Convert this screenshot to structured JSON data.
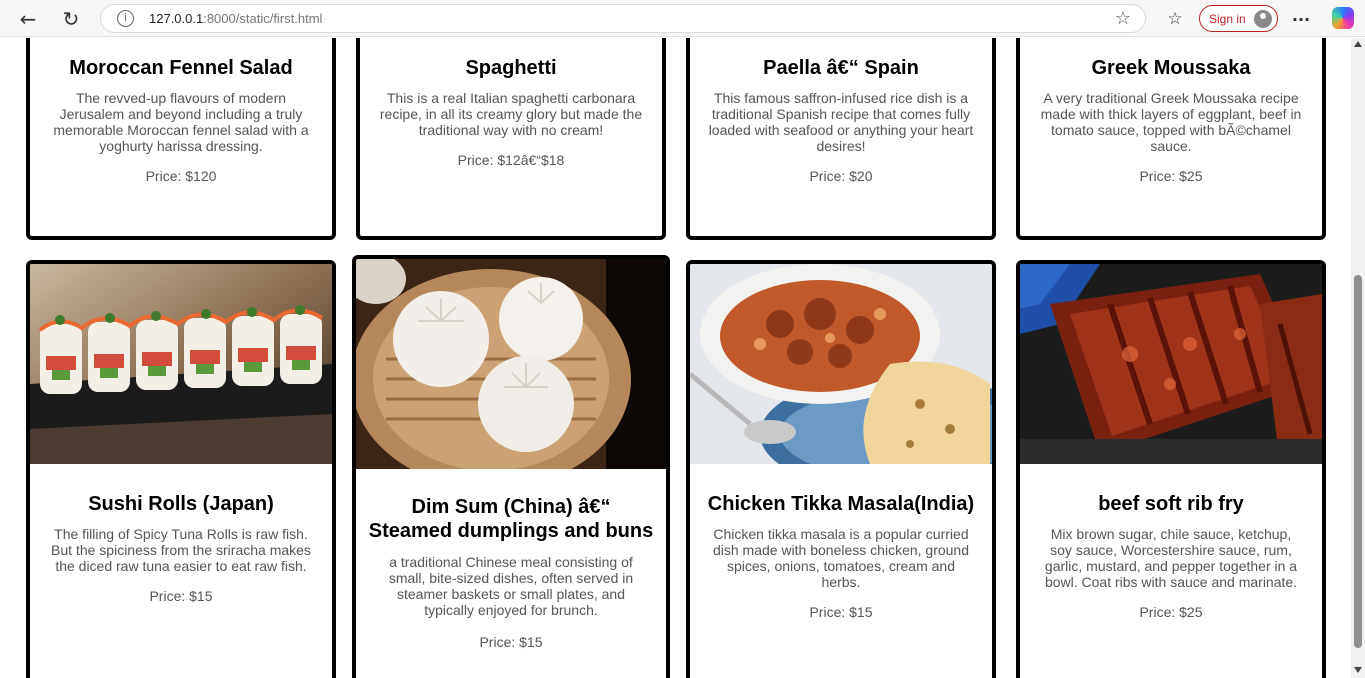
{
  "browser": {
    "url_host": "127.0.0.1",
    "url_rest": ":8000/static/first.html",
    "signin_label": "Sign in"
  },
  "cards_top": [
    {
      "title": "Moroccan Fennel Salad",
      "desc": "The revved-up flavours of modern Jerusalem and beyond including a truly memorable Moroccan fennel salad with a yoghurty harissa dressing.",
      "price": "Price: $120"
    },
    {
      "title": "Spaghetti",
      "desc": "This is a real Italian spaghetti carbonara recipe, in all its creamy glory but made the traditional way with no cream!",
      "price": "Price: $12â€“$18"
    },
    {
      "title": "Paella â€“ Spain",
      "desc": "This famous saffron-infused rice dish is a traditional Spanish recipe that comes fully loaded with seafood or anything your heart desires!",
      "price": "Price: $20"
    },
    {
      "title": "Greek Moussaka",
      "desc": "A very traditional Greek Moussaka recipe made with thick layers of eggplant, beef in tomato sauce, topped with bÃ©chamel sauce.",
      "price": "Price: $25"
    }
  ],
  "cards_bottom": [
    {
      "title": "Sushi Rolls (Japan)",
      "desc": "The filling of Spicy Tuna Rolls is raw fish. But the spiciness from the sriracha makes the diced raw tuna easier to eat raw fish.",
      "price": "Price: $15"
    },
    {
      "title": "Dim Sum (China) â€“ Steamed dumplings and buns",
      "desc": "a traditional Chinese meal consisting of small, bite-sized dishes, often served in steamer baskets or small plates, and typically enjoyed for brunch.",
      "price": "Price: $15"
    },
    {
      "title": "Chicken Tikka Masala(India)",
      "desc": "Chicken tikka masala is a popular curried dish made with boneless chicken, ground spices, onions, tomatoes, cream and herbs.",
      "price": "Price: $15"
    },
    {
      "title": "beef soft rib fry",
      "desc": "Mix brown sugar, chile sauce, ketchup, soy sauce, Worcestershire sauce, rum, garlic, mustard, and pepper together in a bowl. Coat ribs with sauce and marinate.",
      "price": "Price: $25"
    }
  ]
}
